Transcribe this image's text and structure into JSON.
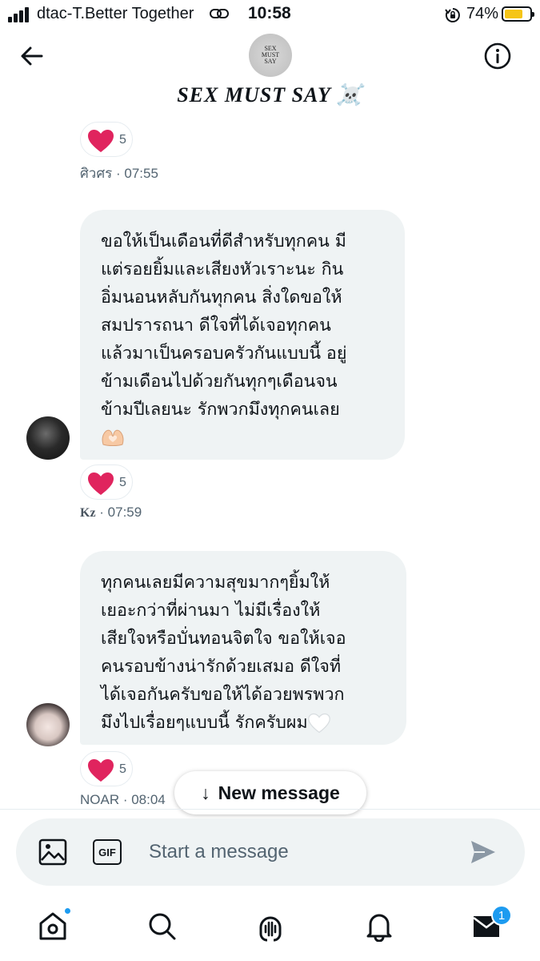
{
  "status_bar": {
    "carrier": "dtac-T.Better Together",
    "time": "10:58",
    "battery_percent": "74%",
    "battery_level": 0.74,
    "icons": [
      "signal-icon",
      "link-icon",
      "rotation-lock-icon",
      "battery-icon"
    ]
  },
  "header": {
    "group_name": "SEX MUST SAY ☠️",
    "avatar_text": [
      "SEX",
      "MUST",
      "SAY"
    ],
    "icons": [
      "back-arrow-icon",
      "info-icon"
    ]
  },
  "messages": [
    {
      "reaction_count": "5",
      "meta": "ศิวศร · 07:55"
    },
    {
      "text": "ขอให้เป็นเดือนที่ดีสำหรับทุกคน มี\nแต่รอยยิ้มและเสียงหัวเราะนะ กิน\nอิ่มนอนหลับกันทุกคน สิ่งใดขอให้\nสมปรารถนา ดีใจที่ได้เจอทุกคน\nแล้วมาเป็นครอบครัวกันแบบนี้ อยู่\nข้ามเดือนไปด้วยกันทุกๆเดือนจน\nข้ามปีเลยนะ รักพวกมึงทุกคนเลย",
      "emoji": "heart-hands-icon",
      "reaction_count": "5",
      "sender": "Kz",
      "time": " · 07:59"
    },
    {
      "text": "ทุกคนเลยมีความสุขมากๆยิ้มให้\nเยอะกว่าที่ผ่านมา ไม่มีเรื่องให้\nเสียใจหรือบั่นทอนจิตใจ ขอให้เจอ\nคนรอบข้างน่ารักด้วยเสมอ ดีใจที่\nได้เจอกันครับขอให้ได้อวยพรพวก\nมึงไปเรื่อยๆแบบนี้ รักครับผม",
      "emoji": "white-heart-icon",
      "reaction_count": "5",
      "meta": "NOAR · 08:04"
    }
  ],
  "new_message_pill": {
    "arrow": "↓",
    "label": "New message"
  },
  "composer": {
    "placeholder": "Start a message",
    "gif_label": "GIF"
  },
  "bottom_nav": {
    "items": [
      "home-icon",
      "search-icon",
      "spaces-icon",
      "notifications-icon",
      "messages-icon"
    ],
    "messages_badge": "1"
  },
  "colors": {
    "accent": "#1d9bf0",
    "heart": "#f91880",
    "bubble": "#eff3f4",
    "secondary_text": "#536471",
    "battery": "#f5c518"
  }
}
